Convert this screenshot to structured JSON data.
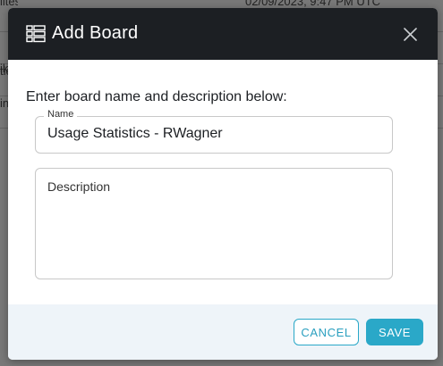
{
  "background": {
    "rows": [
      {
        "left_text": "lites",
        "date": "02/09/2023, 9:47 PM UTC"
      },
      {
        "left_text": "ik",
        "date": ""
      },
      {
        "left_text": "tic",
        "date": ""
      },
      {
        "left_text": "in",
        "date": ""
      }
    ]
  },
  "modal": {
    "title": "Add Board",
    "icon": "board-grid-icon",
    "close_icon": "close-icon",
    "instructions": "Enter board name and description below:",
    "name_label": "Name",
    "name_value": "Usage Statistics - RWagner",
    "description_placeholder": "Description",
    "description_value": "",
    "cancel_label": "CANCEL",
    "save_label": "SAVE"
  },
  "colors": {
    "header_bg": "#1c1f23",
    "accent": "#2aa8c8",
    "footer_bg": "#eef4f9"
  }
}
